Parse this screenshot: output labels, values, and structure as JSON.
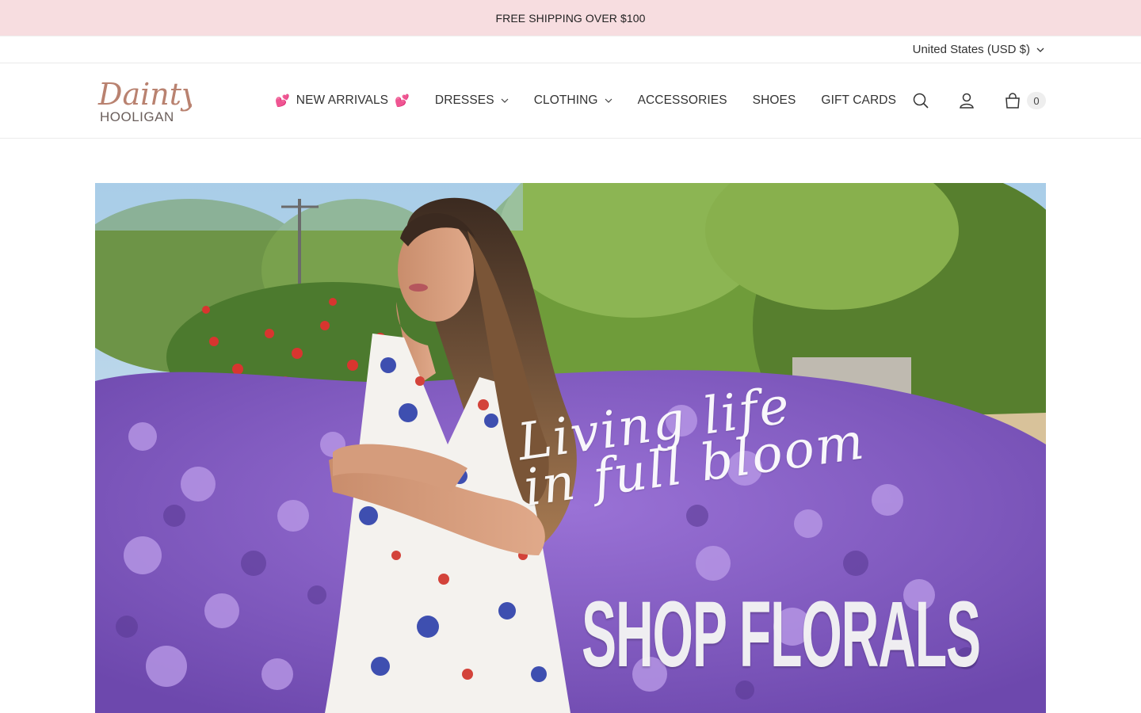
{
  "announcement": {
    "text": "FREE SHIPPING OVER $100"
  },
  "utility": {
    "currency": "United States (USD $)"
  },
  "brand": {
    "logo_line1": "Dainty",
    "logo_line2": "HOOLIGAN",
    "logo_color": "#b98270"
  },
  "nav": {
    "items": [
      {
        "label": "NEW ARRIVALS",
        "prefix_icon": "hearts-emoji",
        "suffix_icon": "hearts-emoji",
        "has_dropdown": false
      },
      {
        "label": "DRESSES",
        "has_dropdown": true
      },
      {
        "label": "CLOTHING",
        "has_dropdown": true
      },
      {
        "label": "ACCESSORIES",
        "has_dropdown": false
      },
      {
        "label": "SHOES",
        "has_dropdown": false
      },
      {
        "label": "GIFT CARDS",
        "has_dropdown": false
      }
    ]
  },
  "header_icons": {
    "search": "search-icon",
    "account": "account-icon",
    "cart": "cart-icon",
    "cart_count": "0"
  },
  "hero": {
    "script_line1": "Living life",
    "script_line2": "in full bloom",
    "cta": "SHOP FLORALS"
  },
  "colors": {
    "announcement_bg": "#f7dde0",
    "text": "#2b2b2b",
    "lavender": "#8c63c9",
    "foliage": "#5f8f32"
  }
}
